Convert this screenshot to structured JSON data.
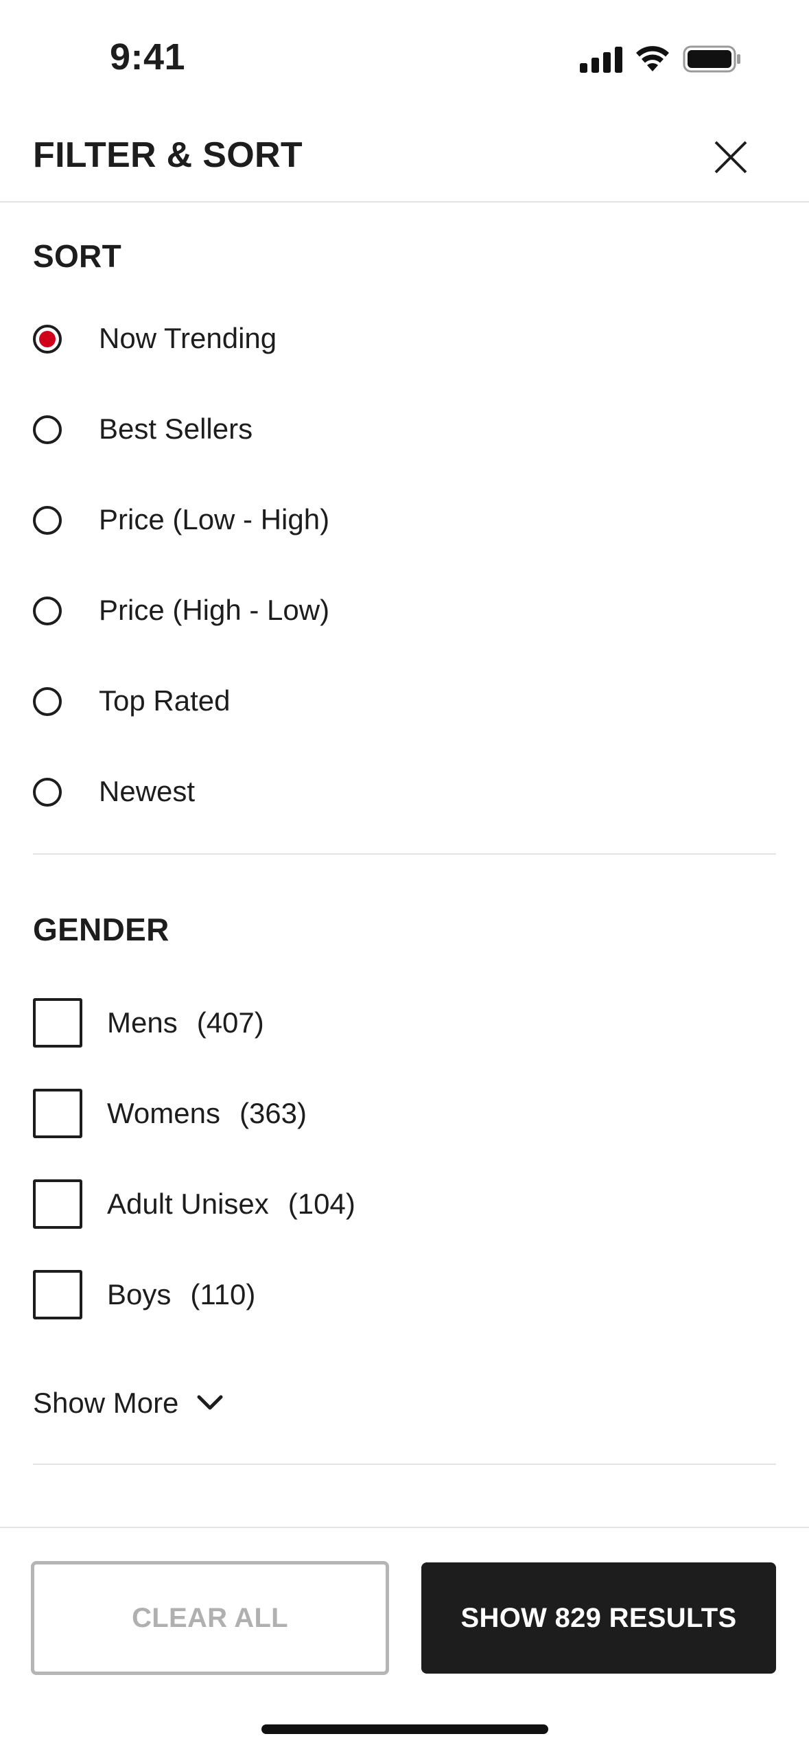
{
  "status_bar": {
    "time": "9:41"
  },
  "header": {
    "title": "FILTER & SORT"
  },
  "sort": {
    "title": "SORT",
    "selected": "Now Trending",
    "options": [
      "Now Trending",
      "Best Sellers",
      "Price (Low - High)",
      "Price (High - Low)",
      "Top Rated",
      "Newest"
    ]
  },
  "gender": {
    "title": "GENDER",
    "options": [
      {
        "label": "Mens",
        "count": "(407)"
      },
      {
        "label": "Womens",
        "count": "(363)"
      },
      {
        "label": "Adult Unisex",
        "count": "(104)"
      },
      {
        "label": "Boys",
        "count": "(110)"
      }
    ],
    "show_more": "Show More"
  },
  "footer": {
    "clear_all": "CLEAR ALL",
    "show_results": "SHOW 829 RESULTS"
  },
  "colors": {
    "accent": "#d0021b",
    "text": "#1d1d1d",
    "divider": "#e3e3e3",
    "disabled": "#b0b0b0"
  }
}
